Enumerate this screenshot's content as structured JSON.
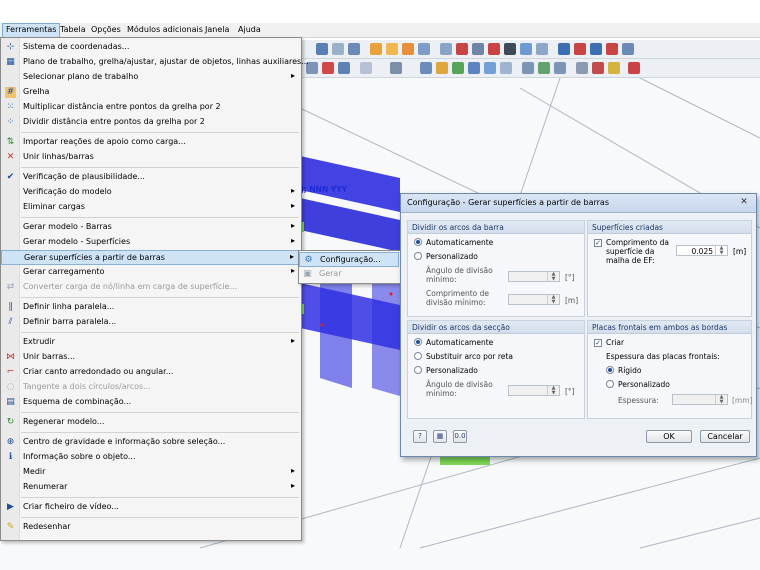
{
  "menubar": {
    "items": [
      "Ferramentas",
      "Tabela",
      "Opções",
      "Módulos adicionais",
      "Janela",
      "Ajuda"
    ]
  },
  "tools_menu": {
    "items": [
      {
        "label": "Sistema de coordenadas...",
        "icon": "axes-icon"
      },
      {
        "label": "Plano de trabalho, grelha/ajustar, ajustar de objetos, linhas auxiliares...",
        "icon": "workplane-icon"
      },
      {
        "label": "Selecionar plano de trabalho",
        "icon": "",
        "arrow": true
      },
      {
        "label": "Grelha",
        "icon": "grid-icon"
      },
      {
        "label": "Multiplicar distância entre pontos da grelha por 2",
        "icon": "grid-multiply-icon"
      },
      {
        "label": "Dividir distância entre pontos da grelha por 2",
        "icon": "grid-divide-icon"
      },
      {
        "label": "Importar reações de apoio como carga...",
        "icon": "import-reactions-icon"
      },
      {
        "label": "Unir linhas/barras",
        "icon": "join-lines-icon"
      },
      {
        "label": "Verificação de plausibilidade...",
        "icon": "plausibility-icon"
      },
      {
        "label": "Verificação do modelo",
        "icon": "",
        "arrow": true
      },
      {
        "label": "Eliminar cargas",
        "icon": "",
        "arrow": true
      },
      {
        "label": "Gerar modelo - Barras",
        "icon": "",
        "arrow": true
      },
      {
        "label": "Gerar modelo - Superfícies",
        "icon": "",
        "arrow": true
      },
      {
        "label": "Gerar superfícies a partir de barras",
        "icon": "",
        "arrow": true
      },
      {
        "label": "Gerar carregamento",
        "icon": "",
        "arrow": true
      },
      {
        "label": "Converter carga de nó/linha em carga de superfície...",
        "icon": "convert-load-icon"
      },
      {
        "label": "Definir linha paralela...",
        "icon": "parallel-line-icon"
      },
      {
        "label": "Definir barra paralela...",
        "icon": "parallel-member-icon"
      },
      {
        "label": "Extrudir",
        "icon": "",
        "arrow": true
      },
      {
        "label": "Unir barras...",
        "icon": "join-members-icon"
      },
      {
        "label": "Criar canto arredondado ou angular...",
        "icon": "fillet-icon"
      },
      {
        "label": "Tangente a dois círculos/arcos...",
        "icon": "tangent-icon"
      },
      {
        "label": "Esquema de combinação...",
        "icon": "combination-icon"
      },
      {
        "label": "Regenerar modelo...",
        "icon": "regenerate-icon"
      },
      {
        "label": "Centro de gravidade e informação sobre seleção...",
        "icon": "centroid-icon"
      },
      {
        "label": "Informação sobre o objeto...",
        "icon": "info-icon"
      },
      {
        "label": "Medir",
        "icon": "",
        "arrow": true
      },
      {
        "label": "Renumerar",
        "icon": "",
        "arrow": true
      },
      {
        "label": "Criar ficheiro de vídeo...",
        "icon": "video-icon"
      },
      {
        "label": "Redesenhar",
        "icon": "redraw-icon"
      }
    ]
  },
  "submenu": {
    "items": [
      "Configuração...",
      "Gerar"
    ]
  },
  "viewport": {
    "label": "J; NNN YYY"
  },
  "dialog": {
    "title": "Configuração - Gerar superfícies a partir de barras",
    "close": "✕",
    "divide_member_arcs": {
      "heading": "Dividir os arcos da barra",
      "opt_auto": "Automaticamente",
      "opt_custom": "Personalizado",
      "min_angle_label": "Ângulo de divisão mínimo:",
      "min_angle_unit": "[°]",
      "min_length_label": "Comprimento de divisão mínimo:",
      "min_length_unit": "[m]"
    },
    "created_surfaces": {
      "heading": "Superfícies criadas",
      "mesh_length_label": "Comprimento da superfície da malha de EF:",
      "mesh_length_value": "0.025",
      "mesh_length_unit": "[m]"
    },
    "divide_section_arcs": {
      "heading": "Dividir os arcos da secção",
      "opt_auto": "Automaticamente",
      "opt_replace": "Substituir arco por reta",
      "opt_custom": "Personalizado",
      "min_angle_label": "Ângulo de divisão mínimo:",
      "min_angle_unit": "[°]"
    },
    "end_plates": {
      "heading": "Placas frontais em ambos as bordas",
      "create_label": "Criar",
      "thickness_heading": "Espessura das placas frontais:",
      "opt_rigid": "Rígido",
      "opt_custom": "Personalizado",
      "thickness_label": "Espessura:",
      "thickness_unit": "[mm]"
    },
    "ok": "OK",
    "cancel": "Cancelar"
  }
}
